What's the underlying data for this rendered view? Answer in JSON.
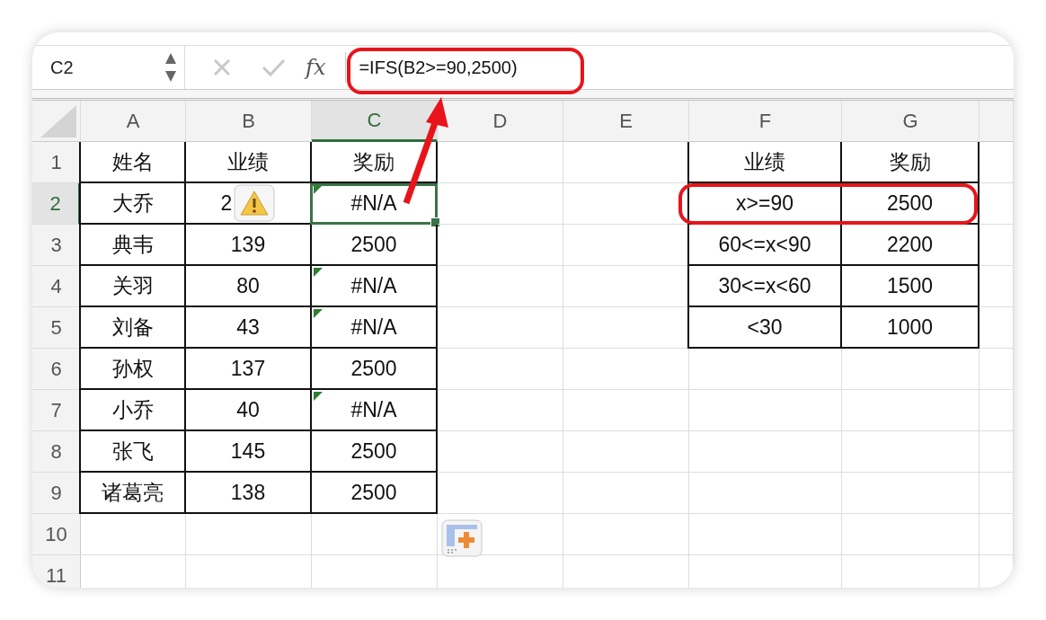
{
  "name_box": {
    "value": "C2"
  },
  "formula_bar": {
    "fx": "fx",
    "formula": "=IFS(B2>=90,2500)",
    "circled": true
  },
  "columns": [
    {
      "label": "A",
      "selected": false
    },
    {
      "label": "B",
      "selected": false
    },
    {
      "label": "C",
      "selected": true
    },
    {
      "label": "D",
      "selected": false
    },
    {
      "label": "E",
      "selected": false
    },
    {
      "label": "F",
      "selected": false
    },
    {
      "label": "G",
      "selected": false
    }
  ],
  "rows": [
    {
      "label": "1",
      "selected": false,
      "cells": {
        "A": {
          "text": "姓名"
        },
        "B": {
          "text": "业绩"
        },
        "C": {
          "text": "奖励"
        },
        "F": {
          "text": "业绩"
        },
        "G": {
          "text": "奖励"
        }
      }
    },
    {
      "label": "2",
      "selected": true,
      "cells": {
        "A": {
          "text": "大乔"
        },
        "B": {
          "text": "2",
          "warning": true
        },
        "C": {
          "text": "#N/A",
          "error_flag": true,
          "selected": true
        },
        "F": {
          "text": "x>=90",
          "circled": true
        },
        "G": {
          "text": "2500",
          "circled": true
        }
      }
    },
    {
      "label": "3",
      "selected": false,
      "cells": {
        "A": {
          "text": "典韦"
        },
        "B": {
          "text": "139"
        },
        "C": {
          "text": "2500"
        },
        "F": {
          "text": "60<=x<90"
        },
        "G": {
          "text": "2200"
        }
      }
    },
    {
      "label": "4",
      "selected": false,
      "cells": {
        "A": {
          "text": "关羽"
        },
        "B": {
          "text": "80"
        },
        "C": {
          "text": "#N/A",
          "error_flag": true
        },
        "F": {
          "text": "30<=x<60"
        },
        "G": {
          "text": "1500"
        }
      }
    },
    {
      "label": "5",
      "selected": false,
      "cells": {
        "A": {
          "text": "刘备"
        },
        "B": {
          "text": "43"
        },
        "C": {
          "text": "#N/A",
          "error_flag": true
        },
        "F": {
          "text": "<30"
        },
        "G": {
          "text": "1000"
        }
      }
    },
    {
      "label": "6",
      "selected": false,
      "cells": {
        "A": {
          "text": "孙权"
        },
        "B": {
          "text": "137"
        },
        "C": {
          "text": "2500"
        }
      }
    },
    {
      "label": "7",
      "selected": false,
      "cells": {
        "A": {
          "text": "小乔"
        },
        "B": {
          "text": "40"
        },
        "C": {
          "text": "#N/A",
          "error_flag": true
        }
      }
    },
    {
      "label": "8",
      "selected": false,
      "cells": {
        "A": {
          "text": "张飞"
        },
        "B": {
          "text": "145"
        },
        "C": {
          "text": "2500"
        }
      }
    },
    {
      "label": "9",
      "selected": false,
      "cells": {
        "A": {
          "text": "诸葛亮"
        },
        "B": {
          "text": "138"
        },
        "C": {
          "text": "2500"
        }
      }
    },
    {
      "label": "10",
      "selected": false,
      "cells": {},
      "paste_options": true
    },
    {
      "label": "11",
      "selected": false,
      "cells": {}
    }
  ],
  "annotations": {
    "arrow": true
  }
}
